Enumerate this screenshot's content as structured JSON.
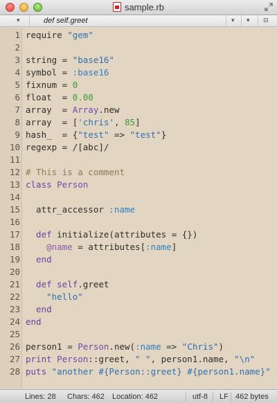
{
  "window": {
    "title": "sample.rb"
  },
  "function_bar": {
    "current_function": "def self.greet"
  },
  "editor": {
    "lines": [
      {
        "n": "1",
        "tokens": [
          {
            "t": "require ",
            "c": "plain"
          },
          {
            "t": "\"gem\"",
            "c": "str"
          }
        ]
      },
      {
        "n": "2",
        "tokens": []
      },
      {
        "n": "3",
        "tokens": [
          {
            "t": "string = ",
            "c": "plain"
          },
          {
            "t": "\"base16\"",
            "c": "str"
          }
        ]
      },
      {
        "n": "4",
        "tokens": [
          {
            "t": "symbol = ",
            "c": "plain"
          },
          {
            "t": ":base16",
            "c": "sym"
          }
        ]
      },
      {
        "n": "5",
        "tokens": [
          {
            "t": "fixnum = ",
            "c": "plain"
          },
          {
            "t": "0",
            "c": "num"
          }
        ]
      },
      {
        "n": "6",
        "tokens": [
          {
            "t": "float  = ",
            "c": "plain"
          },
          {
            "t": "0.00",
            "c": "num"
          }
        ]
      },
      {
        "n": "7",
        "tokens": [
          {
            "t": "array  = ",
            "c": "plain"
          },
          {
            "t": "Array",
            "c": "cls"
          },
          {
            "t": ".new",
            "c": "plain"
          }
        ]
      },
      {
        "n": "8",
        "tokens": [
          {
            "t": "array  = [",
            "c": "plain"
          },
          {
            "t": "'chris'",
            "c": "str"
          },
          {
            "t": ", ",
            "c": "plain"
          },
          {
            "t": "85",
            "c": "num"
          },
          {
            "t": "]",
            "c": "plain"
          }
        ]
      },
      {
        "n": "9",
        "tokens": [
          {
            "t": "hash_  = {",
            "c": "plain"
          },
          {
            "t": "\"test\"",
            "c": "str"
          },
          {
            "t": " => ",
            "c": "plain"
          },
          {
            "t": "\"test\"",
            "c": "str"
          },
          {
            "t": "}",
            "c": "plain"
          }
        ]
      },
      {
        "n": "10",
        "tokens": [
          {
            "t": "regexp = /[abc]/",
            "c": "plain"
          }
        ]
      },
      {
        "n": "11",
        "tokens": []
      },
      {
        "n": "12",
        "tokens": [
          {
            "t": "# This is a comment",
            "c": "com"
          }
        ]
      },
      {
        "n": "13",
        "tokens": [
          {
            "t": "class ",
            "c": "kw"
          },
          {
            "t": "Person",
            "c": "cls"
          }
        ]
      },
      {
        "n": "14",
        "tokens": []
      },
      {
        "n": "15",
        "tokens": [
          {
            "t": "  attr_accessor ",
            "c": "plain"
          },
          {
            "t": ":name",
            "c": "sym"
          }
        ]
      },
      {
        "n": "16",
        "tokens": []
      },
      {
        "n": "17",
        "tokens": [
          {
            "t": "  def ",
            "c": "kw"
          },
          {
            "t": "initialize(attributes = {})",
            "c": "plain"
          }
        ]
      },
      {
        "n": "18",
        "tokens": [
          {
            "t": "    @name",
            "c": "ivar"
          },
          {
            "t": " = attributes[",
            "c": "plain"
          },
          {
            "t": ":name",
            "c": "sym"
          },
          {
            "t": "]",
            "c": "plain"
          }
        ]
      },
      {
        "n": "19",
        "tokens": [
          {
            "t": "  end",
            "c": "kw"
          }
        ]
      },
      {
        "n": "20",
        "tokens": []
      },
      {
        "n": "21",
        "tokens": [
          {
            "t": "  def ",
            "c": "kw"
          },
          {
            "t": "self",
            "c": "kw"
          },
          {
            "t": ".greet",
            "c": "plain"
          }
        ]
      },
      {
        "n": "22",
        "tokens": [
          {
            "t": "    \"hello\"",
            "c": "str"
          }
        ]
      },
      {
        "n": "23",
        "tokens": [
          {
            "t": "  end",
            "c": "kw"
          }
        ]
      },
      {
        "n": "24",
        "tokens": [
          {
            "t": "end",
            "c": "kw"
          }
        ]
      },
      {
        "n": "25",
        "tokens": []
      },
      {
        "n": "26",
        "tokens": [
          {
            "t": "person1 = ",
            "c": "plain"
          },
          {
            "t": "Person",
            "c": "cls"
          },
          {
            "t": ".new(",
            "c": "plain"
          },
          {
            "t": ":name",
            "c": "sym"
          },
          {
            "t": " => ",
            "c": "plain"
          },
          {
            "t": "\"Chris\"",
            "c": "str"
          },
          {
            "t": ")",
            "c": "plain"
          }
        ]
      },
      {
        "n": "27",
        "tokens": [
          {
            "t": "print ",
            "c": "kw"
          },
          {
            "t": "Person",
            "c": "cls"
          },
          {
            "t": "::greet, ",
            "c": "plain"
          },
          {
            "t": "\" \"",
            "c": "str"
          },
          {
            "t": ", person1.name, ",
            "c": "plain"
          },
          {
            "t": "\"\\n\"",
            "c": "str"
          }
        ]
      },
      {
        "n": "28",
        "tokens": [
          {
            "t": "puts ",
            "c": "kw"
          },
          {
            "t": "\"another #{Person::greet} #{person1.name}\"",
            "c": "str"
          }
        ]
      }
    ]
  },
  "status": {
    "lines": "Lines: 28",
    "chars": "Chars: 462",
    "location": "Location: 462",
    "encoding": "utf-8",
    "line_endings": "LF",
    "size": "462 bytes"
  },
  "colors": {
    "editor_background": "#e2d6c3",
    "gutter_background": "#dccfbb",
    "keyword": "#6b3fa0",
    "string": "#2f6fae",
    "number": "#3b9a3b",
    "symbol": "#2f7fbf",
    "comment": "#8c7b55"
  }
}
